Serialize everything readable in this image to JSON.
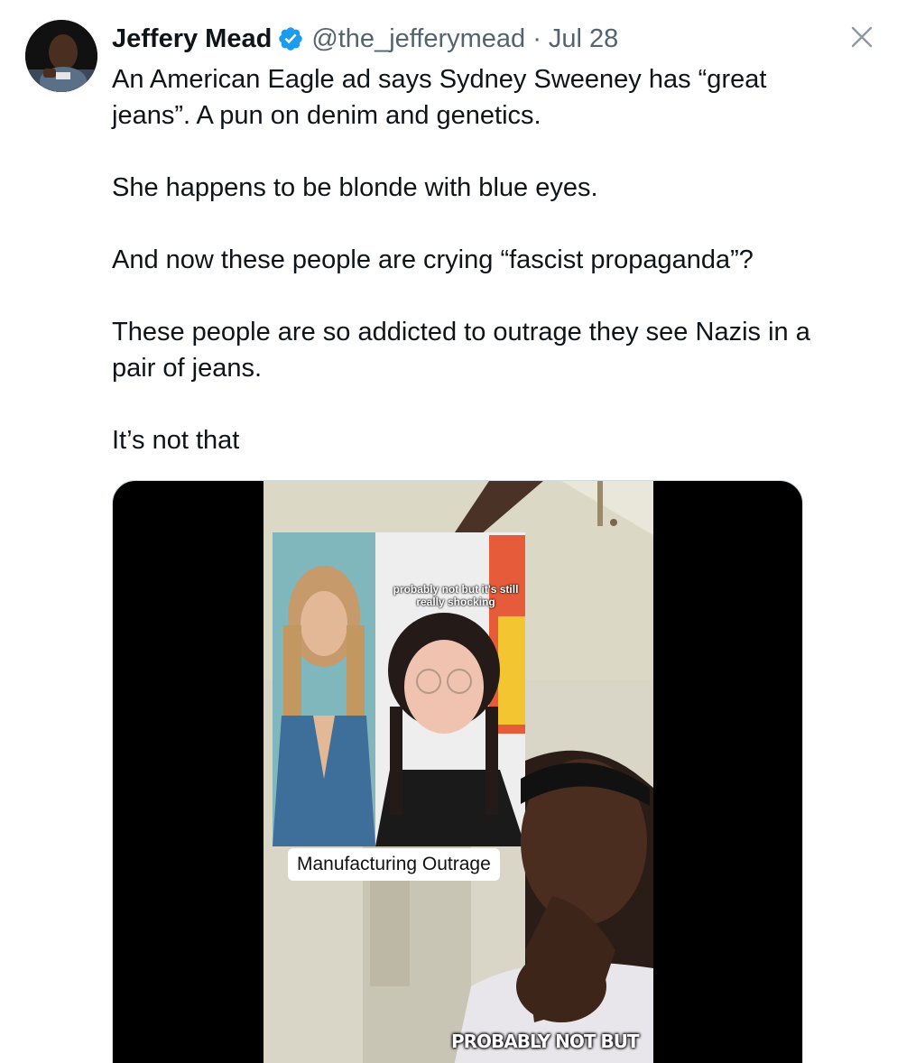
{
  "author": {
    "name": "Jeffery Mead",
    "handle": "@the_jefferymead",
    "separator": "·",
    "date": "Jul 28"
  },
  "tweet": {
    "paragraphs": [
      "An American Eagle ad says Sydney Sweeney has “great jeans”. A pun on denim and genetics.",
      "She happens to be blonde with blue eyes.",
      "And now these people are crying “fascist propaganda”?",
      "These people are so addicted to outrage they see Nazis in a pair of jeans.",
      "It’s not that"
    ]
  },
  "media": {
    "caption_label": "Manufacturing Outrage",
    "inset_overlay_text": "probably not but it's still really shocking",
    "subtitle": "PROBABLY NOT BUT"
  },
  "icons": {
    "verified": "verified-badge-icon",
    "close": "close-icon"
  },
  "colors": {
    "verified_blue": "#1d9bf0",
    "secondary_text": "#536471",
    "primary_text": "#0f1419"
  }
}
